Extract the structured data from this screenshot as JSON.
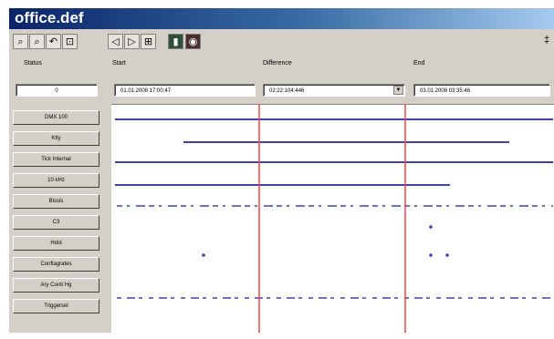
{
  "window": {
    "title": "office.def"
  },
  "toolbar": {
    "icons": [
      "zoom-in-icon",
      "zoom-out-icon",
      "undo-icon",
      "fit-icon",
      "step-back-icon",
      "step-forward-icon",
      "fit-range-icon",
      "delete-icon",
      "record-icon"
    ],
    "glyphs": [
      "⌕",
      "⌕",
      "↶",
      "⊡",
      "◁",
      "▷",
      "⊞",
      "▮",
      "◉"
    ],
    "right_mark": "‡"
  },
  "labels": {
    "status": "Status",
    "start": "Start",
    "difference": "Difference",
    "end": "End"
  },
  "fields": {
    "status_value": "0",
    "start_value": "01.01.2008  17:00:47",
    "difference_value": "02:22:104:446",
    "end_value": "03.01.2008  03:35:46"
  },
  "channels": [
    "DMX 100",
    "Ktty",
    "Tick Internal",
    "10 kHz",
    "Bissis",
    "C3",
    "Hold",
    "Conflagrates",
    "Ary Conti Hg",
    "Triggersel"
  ],
  "markers": {
    "color": "#ff4040"
  },
  "signal_color": "#4040b0"
}
